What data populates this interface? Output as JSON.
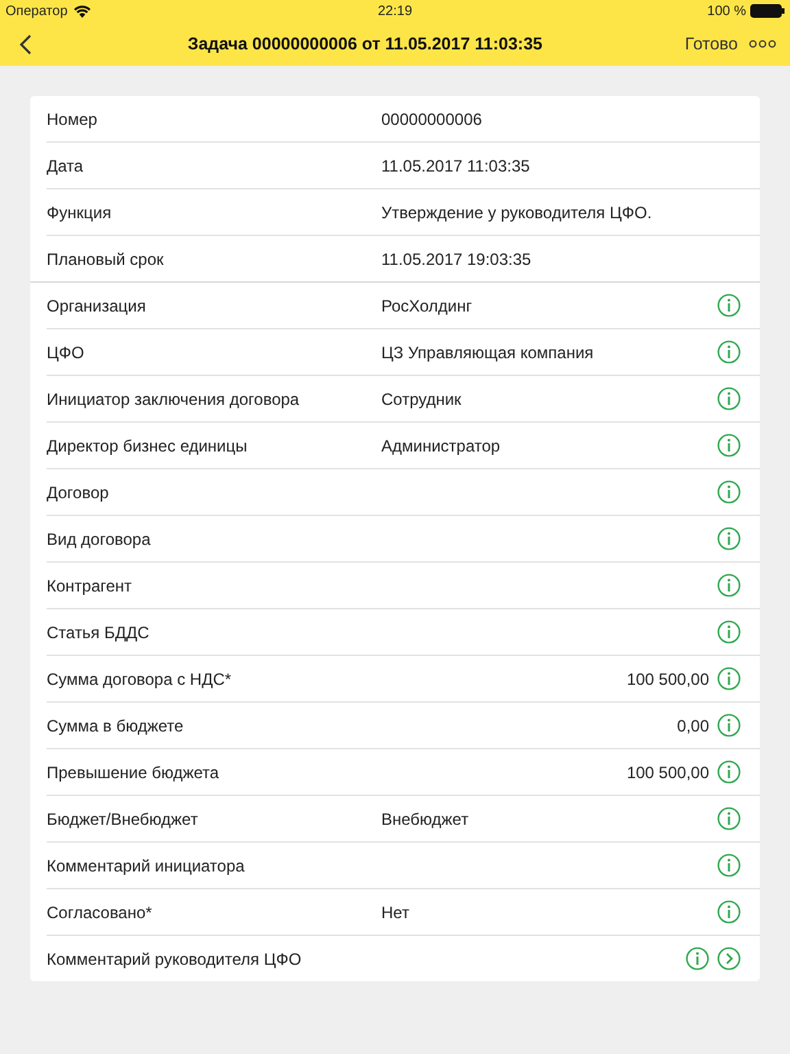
{
  "status_bar": {
    "carrier": "Оператор",
    "time": "22:19",
    "battery": "100 %"
  },
  "header": {
    "title": "Задача 00000000006 от 11.05.2017 11:03:35",
    "done": "Готово"
  },
  "sections": [
    {
      "rows": [
        {
          "label": "Номер",
          "value": "00000000006",
          "kind": "text",
          "info": false,
          "link": false
        },
        {
          "label": "Дата",
          "value": "11.05.2017 11:03:35",
          "kind": "text",
          "info": false,
          "link": false
        },
        {
          "label": "Функция",
          "value": "Утверждение у руководителя ЦФО.",
          "kind": "text",
          "info": false,
          "link": false
        },
        {
          "label": "Плановый срок",
          "value": "11.05.2017 19:03:35",
          "kind": "text",
          "info": false,
          "link": false
        }
      ]
    },
    {
      "rows": [
        {
          "label": "Организация",
          "value": "РосХолдинг",
          "kind": "text",
          "info": true,
          "link": false
        },
        {
          "label": "ЦФО",
          "value": "ЦЗ Управляющая компания",
          "kind": "text",
          "info": true,
          "link": false
        },
        {
          "label": "Инициатор заключения договора",
          "value": "Сотрудник",
          "kind": "text",
          "info": true,
          "link": false
        },
        {
          "label": "Директор бизнес единицы",
          "value": "Администратор",
          "kind": "text",
          "info": true,
          "link": false
        },
        {
          "label": "Договор",
          "info": true,
          "link": false
        },
        {
          "label": "Вид договора",
          "info": true,
          "link": false
        },
        {
          "label": "Контрагент",
          "info": true,
          "link": false
        },
        {
          "label": "Статья БДДС",
          "info": true,
          "link": false
        },
        {
          "label": "Сумма договора с НДС*",
          "value": "100 500,00",
          "kind": "amount",
          "info": true,
          "link": false
        },
        {
          "label": "Сумма в бюджете",
          "value": "0,00",
          "kind": "amount",
          "info": true,
          "link": false
        },
        {
          "label": "Превышение бюджета",
          "value": "100 500,00",
          "kind": "amount",
          "info": true,
          "link": false
        },
        {
          "label": "Бюджет/Внебюджет",
          "value": "Внебюджет",
          "kind": "text",
          "info": true,
          "link": false
        },
        {
          "label": "Комментарий инициатора",
          "info": true,
          "link": false
        },
        {
          "label": "Согласовано*",
          "value": "Нет",
          "kind": "text",
          "info": true,
          "link": false
        },
        {
          "label": "Комментарий руководителя ЦФО",
          "info": true,
          "link": true
        }
      ]
    }
  ]
}
